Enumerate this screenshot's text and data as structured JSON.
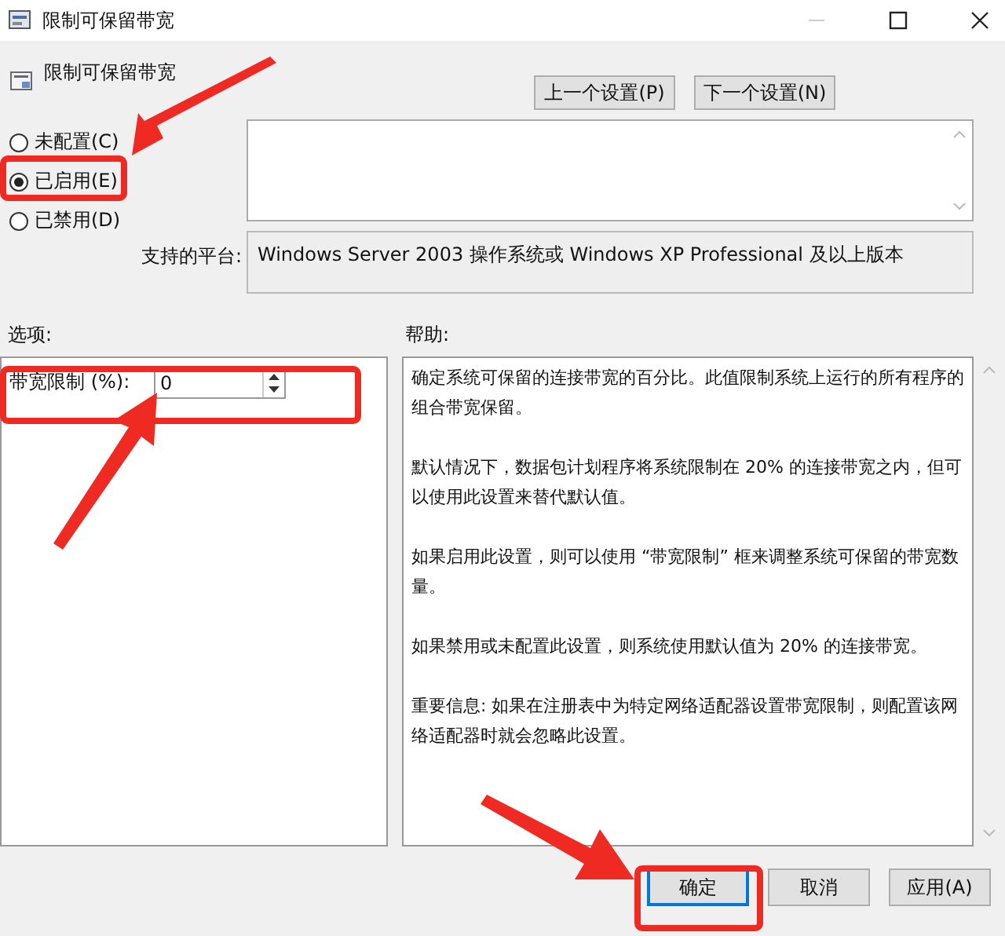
{
  "window": {
    "title": "限制可保留带宽"
  },
  "header": {
    "title": "限制可保留带宽"
  },
  "nav_buttons": [
    {
      "label": "上一个设置(P)"
    },
    {
      "label": "下一个设置(N)"
    }
  ],
  "radios": [
    {
      "label": "未配置(C)",
      "selected": false
    },
    {
      "label": "已启用(E)",
      "selected": true
    },
    {
      "label": "已禁用(D)",
      "selected": false
    }
  ],
  "platform": {
    "label": "支持的平台:",
    "text": "Windows Server 2003 操作系统或 Windows XP Professional 及以上版本"
  },
  "options": {
    "label": "选项:",
    "fields": [
      {
        "label": "带宽限制 (%):",
        "value": "0"
      }
    ]
  },
  "help": {
    "label": "帮助:",
    "paragraphs": [
      "确定系统可保留的连接带宽的百分比。此值限制系统上运行的所有程序的组合带宽保留。",
      "默认情况下，数据包计划程序将系统限制在 20% 的连接带宽之内，但可以使用此设置来替代默认值。",
      "如果启用此设置，则可以使用 “带宽限制” 框来调整系统可保留的带宽数量。",
      "如果禁用或未配置此设置，则系统使用默认值为 20% 的连接带宽。",
      "重要信息: 如果在注册表中为特定网络适配器设置带宽限制，则配置该网络适配器时就会忽略此设置。"
    ]
  },
  "buttons": [
    {
      "label": "确定",
      "focused": true
    },
    {
      "label": "取消",
      "focused": false
    },
    {
      "label": "应用(A)",
      "focused": false
    }
  ]
}
